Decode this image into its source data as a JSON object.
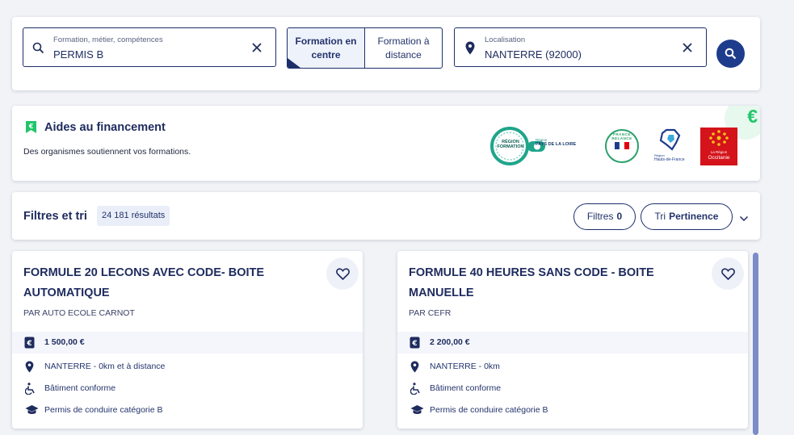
{
  "search": {
    "keyword_label": "Formation, métier, compétences",
    "keyword_value": "PERMIS B",
    "mode_center": "Formation en centre",
    "mode_distance": "Formation à distance",
    "location_label": "Localisation",
    "location_value": "NANTERRE (92000)"
  },
  "funding": {
    "title": "Aides au financement",
    "description": "Des organismes soutiennent vos formations.",
    "logos": {
      "region_formation": "RÉGION FORMATION",
      "pays_loire_pre": "Région",
      "pays_loire": "PAYS DE LA LOIRE",
      "france_relance": "FRANCE RELANCE",
      "hauts_pre": "Région",
      "hauts_de_france": "Hauts-de-France",
      "occitanie_pre": "La Région",
      "occitanie": "Occitanie"
    },
    "euro": "€"
  },
  "filters": {
    "title": "Filtres et tri",
    "results_count": "24 181",
    "results_label": "résultats",
    "filters_label": "Filtres",
    "filters_count": "0",
    "sort_label": "Tri",
    "sort_value": "Pertinence"
  },
  "results": [
    {
      "title": "FORMULE 20 LECONS AVEC CODE- BOITE AUTOMATIQUE",
      "provider": "PAR AUTO ECOLE CARNOT",
      "price": "1 500,00 €",
      "location": "NANTERRE - 0km et à distance",
      "accessibility": "Bâtiment conforme",
      "certification": "Permis de conduire catégorie B"
    },
    {
      "title": "FORMULE 40 HEURES SANS CODE - BOITE MANUELLE",
      "provider": "PAR CEFR",
      "price": "2 200,00 €",
      "location": "NANTERRE - 0km",
      "accessibility": "Bâtiment conforme",
      "certification": "Permis de conduire catégorie B"
    }
  ],
  "colors": {
    "primary": "#1e3c8c",
    "text": "#1e2b5e",
    "accent_green": "#21c56a"
  }
}
